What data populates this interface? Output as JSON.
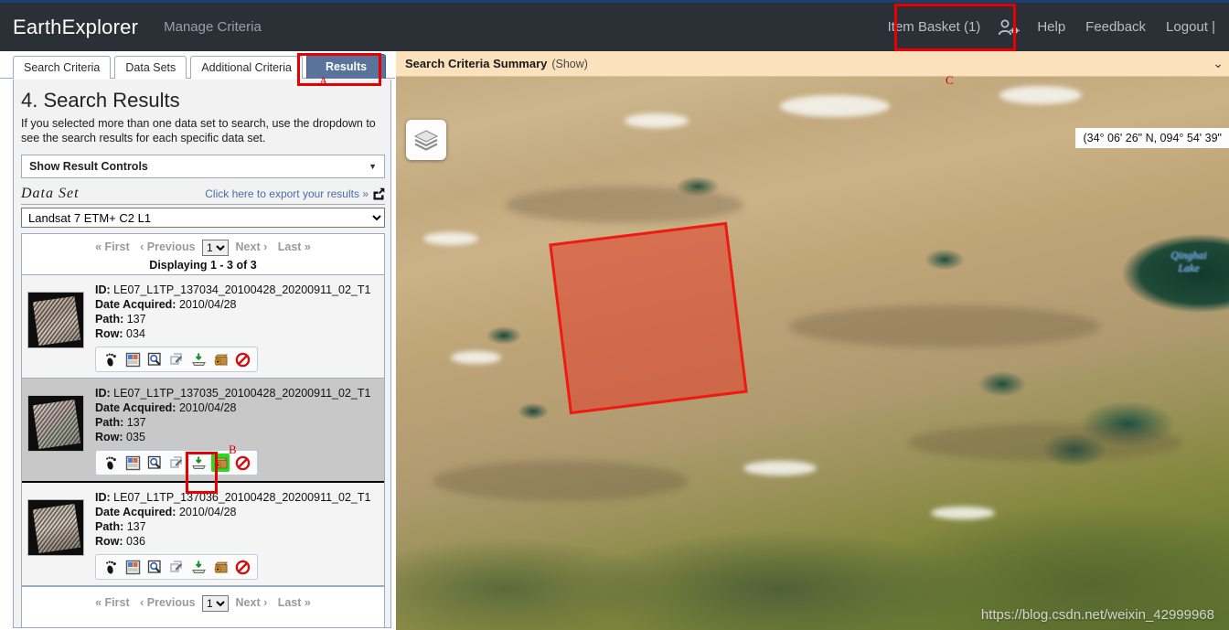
{
  "topbar": {
    "brand": "EarthExplorer",
    "manage_criteria": "Manage Criteria",
    "item_basket": "Item Basket (1)",
    "person_icon": "person-gear-icon",
    "help": "Help",
    "feedback": "Feedback",
    "logout": "Logout |"
  },
  "annotations": [
    {
      "letter": "A"
    },
    {
      "letter": "B"
    },
    {
      "letter": "C"
    }
  ],
  "tabs": [
    {
      "label": "Search Criteria",
      "active": false
    },
    {
      "label": "Data Sets",
      "active": false
    },
    {
      "label": "Additional Criteria",
      "active": false
    },
    {
      "label": "Results",
      "active": true
    }
  ],
  "results_panel": {
    "title": "4. Search Results",
    "description": "If you selected more than one data set to search, use the dropdown to see the search results for each specific data set.",
    "show_result_controls": "Show Result Controls",
    "caret_icon": "chevron-down-icon",
    "data_set_label": "Data Set",
    "export_link": "Click here to export your results »",
    "export_icon": "external-link-icon",
    "dataset_selected": "Landsat 7 ETM+ C2 L1",
    "dataset_options": [
      "Landsat 7 ETM+ C2 L1"
    ],
    "pager": {
      "first": "« First",
      "previous": "‹ Previous",
      "page_value": "1",
      "page_options": [
        "1"
      ],
      "next": "Next ›",
      "last": "Last »",
      "displaying": "Displaying 1 - 3 of 3"
    },
    "item_icons": [
      "show-footprint-icon",
      "show-browse-overlay-icon",
      "show-metadata-icon",
      "compare-browse-icon",
      "download-options-icon",
      "bulk-download-order-icon",
      "exclude-scene-icon"
    ],
    "items": [
      {
        "id_label": "ID:",
        "id": "LE07_L1TP_137034_20100428_20200911_02_T1",
        "date_label": "Date Acquired:",
        "date": "2010/04/28",
        "path_label": "Path:",
        "path": "137",
        "row_label": "Row:",
        "row": "034",
        "selected": false,
        "order_active": false
      },
      {
        "id_label": "ID:",
        "id": "LE07_L1TP_137035_20100428_20200911_02_T1",
        "date_label": "Date Acquired:",
        "date": "2010/04/28",
        "path_label": "Path:",
        "path": "137",
        "row_label": "Row:",
        "row": "035",
        "selected": true,
        "order_active": true
      },
      {
        "id_label": "ID:",
        "id": "LE07_L1TP_137036_20100428_20200911_02_T1",
        "date_label": "Date Acquired:",
        "date": "2010/04/28",
        "path_label": "Path:",
        "path": "137",
        "row_label": "Row:",
        "row": "036",
        "selected": false,
        "order_active": false
      }
    ]
  },
  "map": {
    "summary_title": "Search Criteria Summary",
    "summary_show": "(Show)",
    "summary_caret": "chevron-down-icon",
    "layers_icon": "layers-icon",
    "coordinates": "(34° 06' 26\" N, 094° 54' 39\"",
    "lake_label": "Qinghai\nLake",
    "lake_label_line1": "Qinghai",
    "lake_label_line2": "Lake",
    "watermark": "https://blog.csdn.net/weixin_42999968",
    "footprint_color": "#ee1b12"
  },
  "colors": {
    "accent": "#5a739c",
    "annotation": "#e60000",
    "topbar": "#2b2f36",
    "summary_bar": "#fbe2bd",
    "selected_row": "#c8c8c8",
    "order_active": "#22dd22"
  }
}
